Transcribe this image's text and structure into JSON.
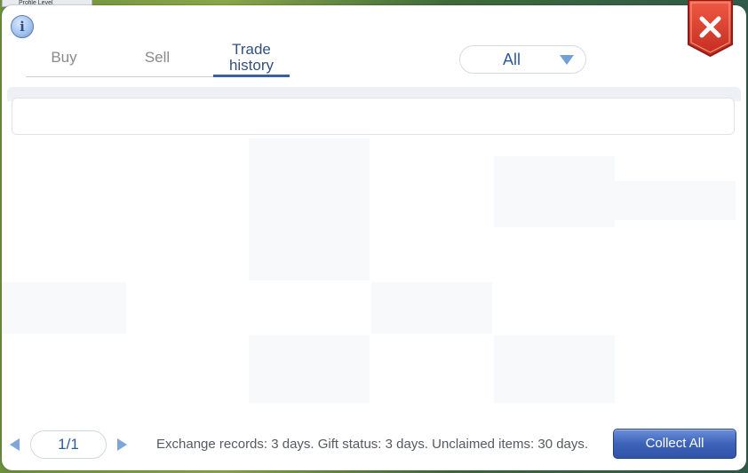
{
  "window": {
    "title_tab": "Profile Level"
  },
  "header": {
    "info_icon": "info-icon",
    "info_glyph": "i",
    "tabs": [
      {
        "label": "Buy"
      },
      {
        "label": "Sell"
      },
      {
        "label": "Trade\nhistory",
        "active": true
      }
    ],
    "filter": {
      "selected": "All",
      "arrow_icon": "triangle-down-icon"
    },
    "close_icon": "close-icon"
  },
  "list": {
    "rows": [
      {
        "content": ""
      }
    ]
  },
  "footer": {
    "page_indicator": "1/1",
    "prev_icon": "left-arrow-icon",
    "next_icon": "right-arrow-icon",
    "note": "Exchange records: 3 days. Gift status: 3 days. Unclaimed items: 30 days.",
    "collect_all_label": "Collect All"
  },
  "colors": {
    "accent": "#3c5ea3",
    "close_red": "#d93a2a",
    "button_blue": "#3d63b9",
    "text_muted": "#8a8a8a"
  }
}
